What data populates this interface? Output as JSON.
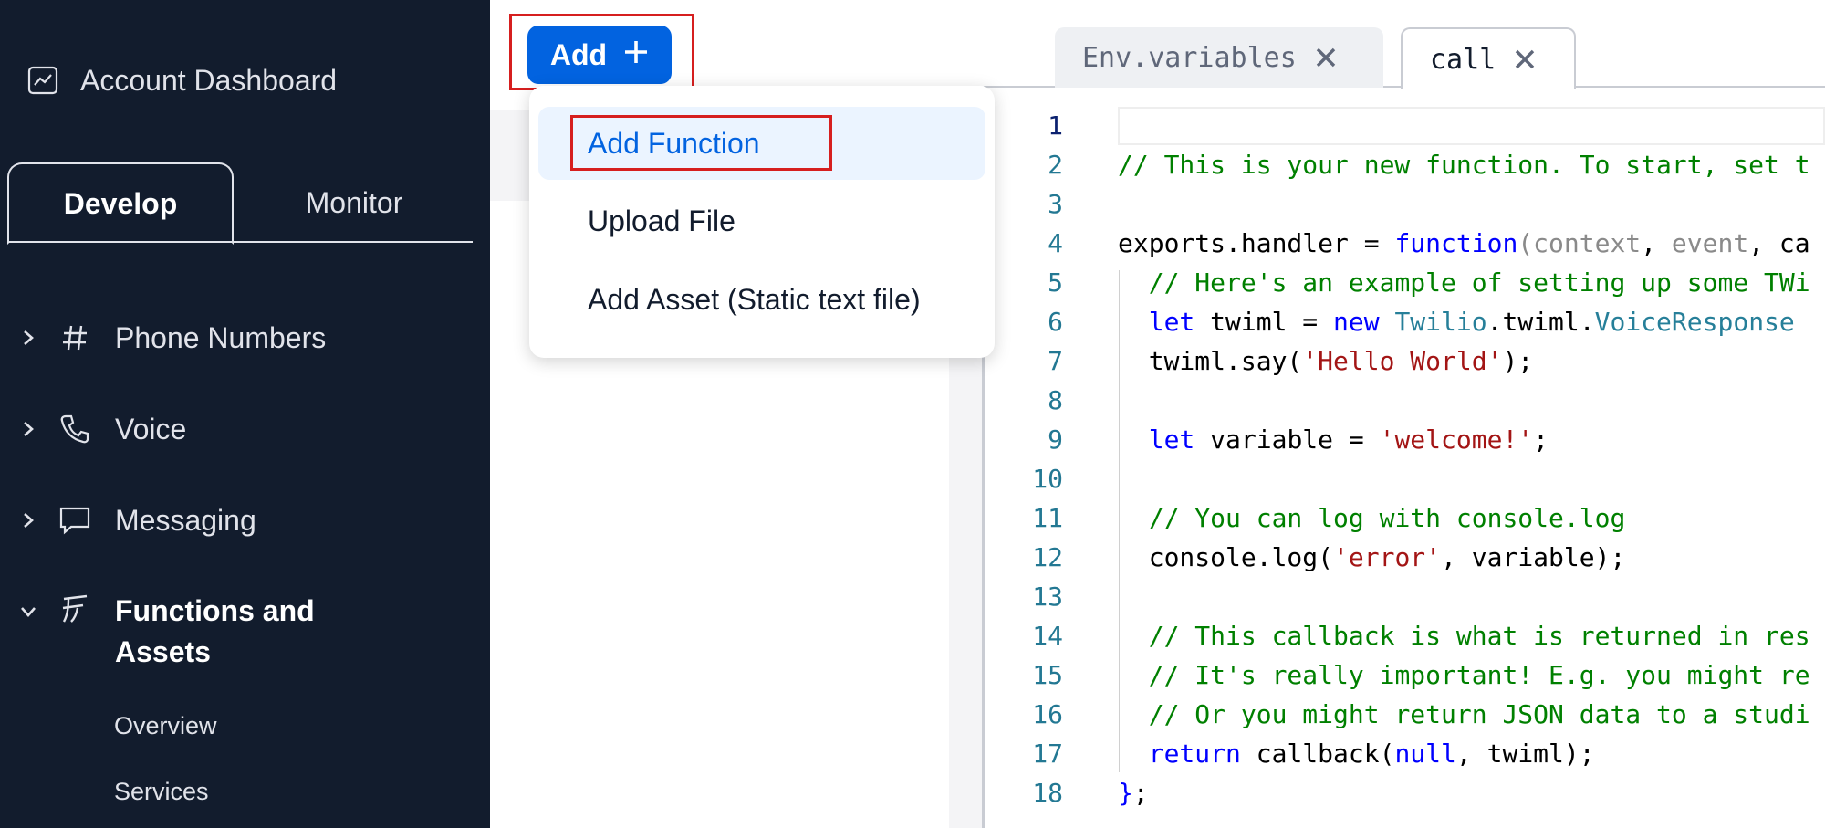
{
  "sidebar": {
    "account_label": "Account Dashboard",
    "tabs": {
      "develop": "Develop",
      "monitor": "Monitor"
    },
    "items": [
      {
        "label": "Phone Numbers",
        "icon": "hash-icon"
      },
      {
        "label": "Voice",
        "icon": "phone-icon"
      },
      {
        "label": "Messaging",
        "icon": "chat-icon"
      },
      {
        "label": "Functions and",
        "label2": "Assets",
        "icon": "functions-icon"
      }
    ],
    "subitems": [
      "Overview",
      "Services"
    ]
  },
  "toolbar": {
    "add_label": "Add",
    "add_symbol": "+"
  },
  "add_menu": {
    "items": [
      "Add Function",
      "Upload File",
      "Add Asset (Static text file)"
    ]
  },
  "editor": {
    "tabs": [
      {
        "label": "Env.variables"
      },
      {
        "label": "call"
      }
    ],
    "colors": {
      "comment": "#008000",
      "keyword": "#0000ff",
      "string": "#a31515",
      "highlight": "#d61f1f",
      "accent": "#0263e0"
    },
    "lines": [
      {
        "n": "1",
        "parts": []
      },
      {
        "n": "2",
        "parts": [
          [
            "c-com",
            "// This is your new function. To start, set t"
          ]
        ]
      },
      {
        "n": "3",
        "parts": []
      },
      {
        "n": "4",
        "parts": [
          [
            "",
            "exports.handler = "
          ],
          [
            "c-kw",
            "function"
          ],
          [
            "c-par",
            "("
          ],
          [
            "c-par",
            "context"
          ],
          [
            "",
            ", "
          ],
          [
            "c-par",
            "event"
          ],
          [
            "",
            ", ca"
          ]
        ]
      },
      {
        "n": "5",
        "parts": [
          [
            "",
            "  "
          ],
          [
            "c-com",
            "// Here's an example of setting up some TWi"
          ]
        ]
      },
      {
        "n": "6",
        "parts": [
          [
            "",
            "  "
          ],
          [
            "c-kw",
            "let"
          ],
          [
            "",
            " twiml = "
          ],
          [
            "c-kw",
            "new"
          ],
          [
            "",
            " "
          ],
          [
            "c-cls",
            "Twilio"
          ],
          [
            "",
            ".twiml."
          ],
          [
            "c-cls",
            "VoiceResponse"
          ]
        ]
      },
      {
        "n": "7",
        "parts": [
          [
            "",
            "  twiml.say("
          ],
          [
            "c-str",
            "'Hello World'"
          ],
          [
            "",
            ");"
          ]
        ]
      },
      {
        "n": "8",
        "parts": []
      },
      {
        "n": "9",
        "parts": [
          [
            "",
            "  "
          ],
          [
            "c-kw",
            "let"
          ],
          [
            "",
            " variable = "
          ],
          [
            "c-str",
            "'welcome!'"
          ],
          [
            "",
            ";"
          ]
        ]
      },
      {
        "n": "10",
        "parts": []
      },
      {
        "n": "11",
        "parts": [
          [
            "",
            "  "
          ],
          [
            "c-com",
            "// You can log with console.log"
          ]
        ]
      },
      {
        "n": "12",
        "parts": [
          [
            "",
            "  console.log("
          ],
          [
            "c-str",
            "'error'"
          ],
          [
            "",
            ", variable);"
          ]
        ]
      },
      {
        "n": "13",
        "parts": []
      },
      {
        "n": "14",
        "parts": [
          [
            "",
            "  "
          ],
          [
            "c-com",
            "// This callback is what is returned in res"
          ]
        ]
      },
      {
        "n": "15",
        "parts": [
          [
            "",
            "  "
          ],
          [
            "c-com",
            "// It's really important! E.g. you might re"
          ]
        ]
      },
      {
        "n": "16",
        "parts": [
          [
            "",
            "  "
          ],
          [
            "c-com",
            "// Or you might return JSON data to a studi"
          ]
        ]
      },
      {
        "n": "17",
        "parts": [
          [
            "",
            "  "
          ],
          [
            "c-kw",
            "return"
          ],
          [
            "",
            " callback("
          ],
          [
            "c-kw",
            "null"
          ],
          [
            "",
            ", twiml);"
          ]
        ]
      },
      {
        "n": "18",
        "parts": [
          [
            "c-kw",
            "}"
          ],
          [
            "",
            ";"
          ]
        ]
      }
    ]
  }
}
